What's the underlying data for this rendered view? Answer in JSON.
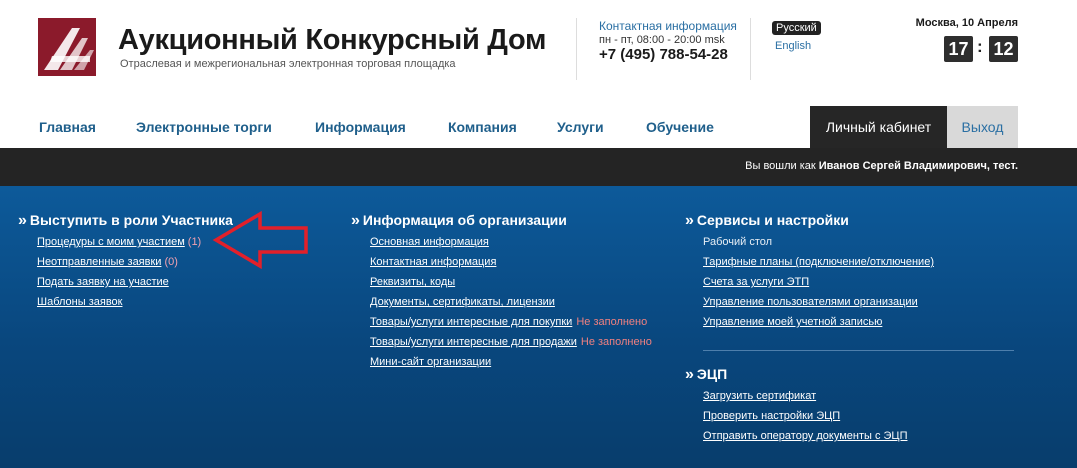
{
  "header": {
    "title": "Аукционный Конкурсный Дом",
    "subtitle": "Отраслевая и межрегиональная электронная торговая площадка",
    "contact_title": "Контактная информация",
    "contact_hours": "пн - пт, 08:00 - 20:00 msk",
    "phone": "+7 (495) 788-54-28",
    "lang_active": "Русский",
    "lang_other": "English",
    "date": "Москва, 10 Апреля",
    "clock_hours": "17",
    "clock_minutes": "12",
    "clock_sep": ":"
  },
  "nav": {
    "items": [
      "Главная",
      "Электронные торги",
      "Информация",
      "Компания",
      "Услуги",
      "Обучение"
    ],
    "cabinet": "Личный кабинет",
    "logout": "Выход"
  },
  "userbar": {
    "prefix": "Вы вошли как ",
    "user": "Иванов Сергей Владимирович, тест."
  },
  "participant": {
    "title": "Выступить в роли Участника",
    "links": [
      {
        "label": "Процедуры с моим участием",
        "count": "(1)"
      },
      {
        "label": "Неотправленные заявки",
        "count": "(0)"
      },
      {
        "label": "Подать заявку на участие"
      },
      {
        "label": "Шаблоны заявок"
      }
    ]
  },
  "organization": {
    "title": "Информация об организации",
    "links": [
      {
        "label": "Основная информация"
      },
      {
        "label": "Контактная информация"
      },
      {
        "label": "Реквизиты, коды"
      },
      {
        "label": "Документы, сертификаты, лицензии"
      },
      {
        "label": "Товары/услуги интересные для покупки",
        "status": "Не заполнено"
      },
      {
        "label": "Товары/услуги интересные для продажи",
        "status": "Не заполнено"
      },
      {
        "label": "Мини-сайт организации"
      }
    ]
  },
  "services": {
    "title": "Сервисы и настройки",
    "current": "Рабочий стол",
    "links": [
      {
        "label": "Тарифные планы (подключение/отключение)"
      },
      {
        "label": "Счета за услуги ЭТП"
      },
      {
        "label": "Управление пользователями организации"
      },
      {
        "label": "Управление моей учетной записью"
      }
    ]
  },
  "ecp": {
    "title": "ЭЦП",
    "links": [
      {
        "label": "Загрузить сертификат"
      },
      {
        "label": "Проверить настройки ЭЦП"
      },
      {
        "label": "Отправить оператору документы с ЭЦП"
      }
    ]
  },
  "colors": {
    "brand": "#8b1a2b",
    "nav_link": "#1f5f8b",
    "panel": "#0a4c86",
    "annotation_arrow": "#e3202a"
  }
}
